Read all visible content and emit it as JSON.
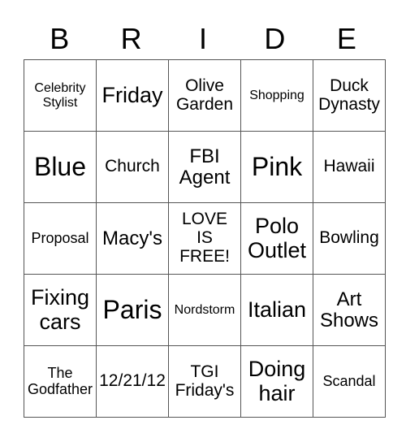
{
  "card": {
    "header": [
      "B",
      "R",
      "I",
      "D",
      "E"
    ],
    "rows": [
      [
        "Celebrity Stylist",
        "Friday",
        "Olive Garden",
        "Shopping",
        "Duck Dynasty"
      ],
      [
        "Blue",
        "Church",
        "FBI Agent",
        "Pink",
        "Hawaii"
      ],
      [
        "Proposal",
        "Macy's",
        "LOVE IS FREE!",
        "Polo Outlet",
        "Bowling"
      ],
      [
        "Fixing cars",
        "Paris",
        "Nordstorm",
        "Italian",
        "Art Shows"
      ],
      [
        "The Godfather",
        "12/21/12",
        "TGI Friday's",
        "Doing hair",
        "Scandal"
      ]
    ]
  },
  "display": {
    "rows": [
      [
        "Celebrity\nStylist",
        "Friday",
        "Olive\nGarden",
        "Shopping",
        "Duck\nDynasty"
      ],
      [
        "Blue",
        "Church",
        "FBI\nAgent",
        "Pink",
        "Hawaii"
      ],
      [
        "Proposal",
        "Macy's",
        "LOVE\nIS\nFREE!",
        "Polo\nOutlet",
        "Bowling"
      ],
      [
        "Fixing\ncars",
        "Paris",
        "Nordstorm",
        "Italian",
        "Art\nShows"
      ],
      [
        "The\nGodfather",
        "12/21/12",
        "TGI\nFriday's",
        "Doing\nhair",
        "Scandal"
      ]
    ]
  }
}
